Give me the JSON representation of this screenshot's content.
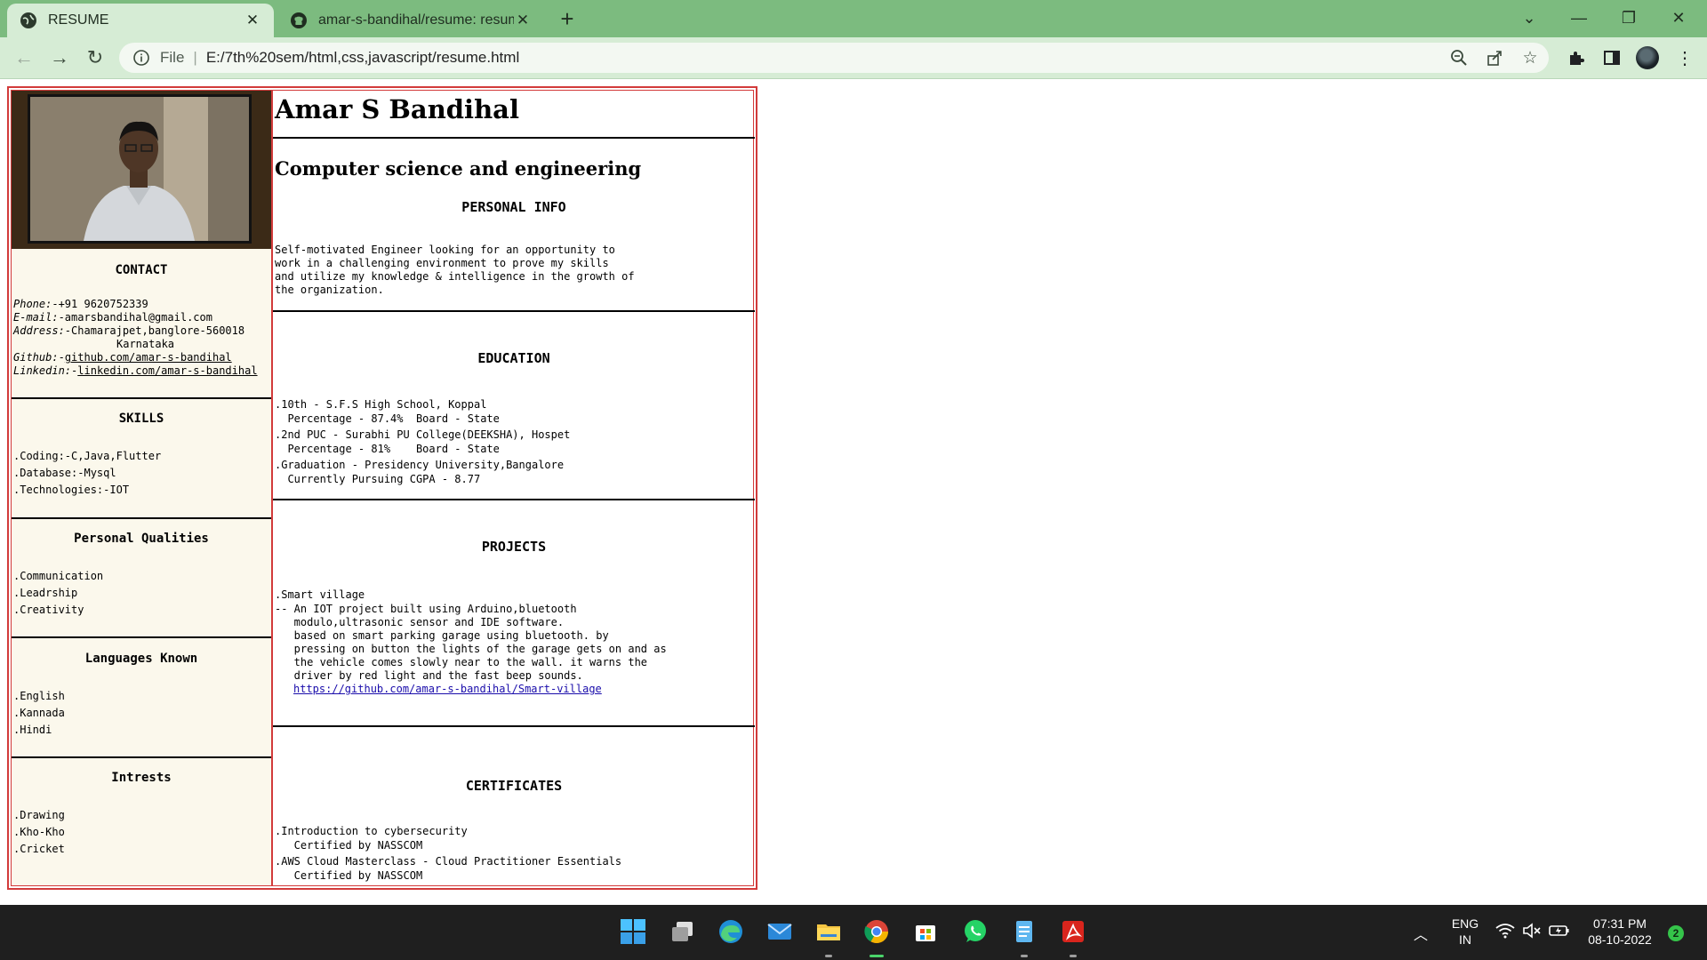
{
  "browser": {
    "tabs": [
      {
        "title": "RESUME",
        "active": true
      },
      {
        "title": "amar-s-bandihal/resume: resume",
        "active": false
      }
    ],
    "address": {
      "scheme_label": "File",
      "url": "E:/7th%20sem/html,css,javascript/resume.html"
    },
    "icons": {
      "back": "arrow-left-icon",
      "forward": "arrow-right-icon",
      "reload": "reload-icon",
      "zoom": "zoom-out-icon",
      "share": "share-icon",
      "bookmark": "star-icon",
      "extensions": "puzzle-icon",
      "sidepanel": "side-panel-icon",
      "profile": "avatar"
    }
  },
  "resume": {
    "name": "Amar S Bandihal",
    "department": "Computer science and engineering",
    "sidebar": {
      "contact": {
        "title": "CONTACT",
        "phone_label": "Phone:",
        "phone": "-+91 9620752339",
        "email_label": "E-mail:",
        "email": "-amarsbandihal@gmail.com",
        "address_label": "Address:",
        "address_line1": "-Chamarajpet,banglore-560018",
        "address_line2": "Karnataka",
        "github_label": "Github:",
        "github_prefix": "-",
        "github": "github.com/amar-s-bandihal",
        "linkedin_label": "Linkedin:",
        "linkedin_prefix": "-",
        "linkedin": "linkedin.com/amar-s-bandihal"
      },
      "skills": {
        "title": "SKILLS",
        "items": [
          ".Coding:-C,Java,Flutter",
          ".Database:-Mysql",
          ".Technologies:-IOT"
        ]
      },
      "qualities": {
        "title": "Personal Qualities",
        "items": [
          ".Communication",
          ".Leadrship",
          ".Creativity"
        ]
      },
      "languages": {
        "title": "Languages Known",
        "items": [
          ".English",
          ".Kannada",
          ".Hindi"
        ]
      },
      "interests": {
        "title": "Intrests",
        "items": [
          ".Drawing",
          ".Kho-Kho",
          ".Cricket"
        ]
      }
    },
    "personal_info": {
      "title": "PERSONAL INFO",
      "text": "Self-motivated Engineer looking for an opportunity to\nwork in a challenging environment to prove my skills\nand utilize my knowledge & intelligence in the growth of\nthe organization."
    },
    "education": {
      "title": "EDUCATION",
      "entries": [
        {
          "line1": ".10th - S.F.S High School, Koppal",
          "line2": "  Percentage - 87.4%  Board - State"
        },
        {
          "line1": ".2nd PUC - Surabhi PU College(DEEKSHA), Hospet",
          "line2": "  Percentage - 81%    Board - State"
        },
        {
          "line1": ".Graduation - Presidency University,Bangalore",
          "line2": "  Currently Pursuing CGPA - 8.77"
        }
      ]
    },
    "projects": {
      "title": "PROJECTS",
      "name": ".Smart village",
      "description": "-- An IOT project built using Arduino,bluetooth\n   modulo,ultrasonic sensor and IDE software.\n   based on smart parking garage using bluetooth. by\n   pressing on button the lights of the garage gets on and as\n   the vehicle comes slowly near to the wall. it warns the\n   driver by red light and the fast beep sounds.",
      "link": "https://github.com/amar-s-bandihal/Smart-village"
    },
    "certificates": {
      "title": "CERTIFICATES",
      "entries": [
        {
          "line1": ".Introduction to cybersecurity",
          "line2": "   Certified by NASSCOM"
        },
        {
          "line1": ".AWS Cloud Masterclass - Cloud Practitioner Essentials",
          "line2": "   Certified by NASSCOM"
        }
      ]
    }
  },
  "taskbar": {
    "apps": [
      "windows-start-icon",
      "task-view-icon",
      "edge-icon",
      "mail-icon",
      "file-explorer-icon",
      "chrome-icon",
      "microsoft-store-icon",
      "whatsapp-icon",
      "notepad-icon",
      "acrobat-icon"
    ],
    "language": "ENG",
    "region": "IN",
    "time": "07:31 PM",
    "date": "08-10-2022",
    "notification_count": "2"
  },
  "colors": {
    "tab_strip": "#7cbb7f",
    "toolbar": "#d6ecd5",
    "resume_border": "#d23b3b",
    "sidebar_bg": "#fbf8ec",
    "link": "#1a0dab",
    "taskbar": "#1f1f1f"
  }
}
